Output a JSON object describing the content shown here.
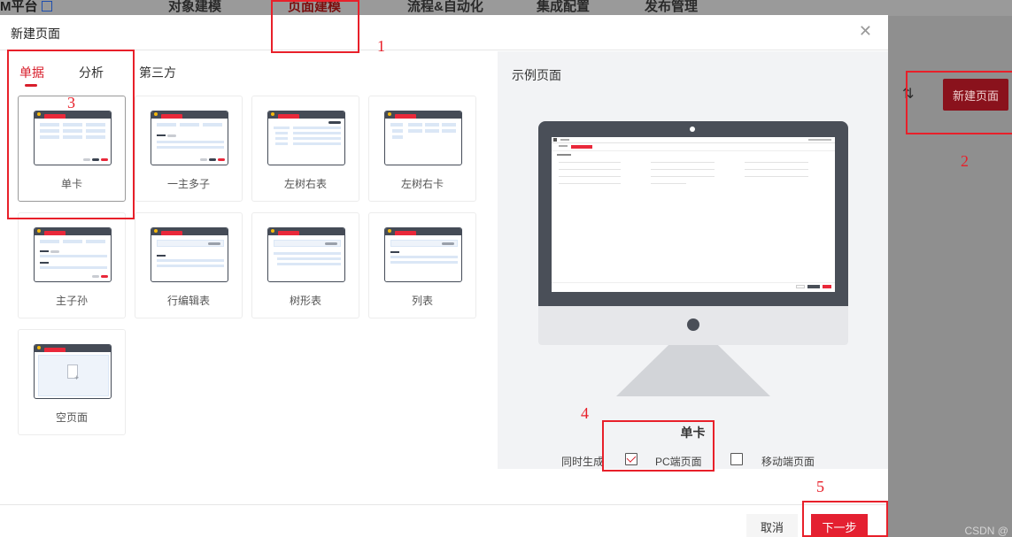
{
  "background": {
    "brand": "M平台",
    "nav": [
      {
        "label": "对象建模",
        "active": false
      },
      {
        "label": "页面建模",
        "active": true
      },
      {
        "label": "流程&自动化",
        "active": false
      },
      {
        "label": "集成配置",
        "active": false
      },
      {
        "label": "发布管理",
        "active": false
      }
    ],
    "new_page_button": "新建页面",
    "watermark": "CSDN @"
  },
  "modal": {
    "title": "新建页面",
    "tabs": [
      {
        "label": "单据",
        "active": true
      },
      {
        "label": "分析",
        "active": false
      },
      {
        "label": "第三方",
        "active": false
      }
    ],
    "templates": [
      {
        "label": "单卡",
        "selected": true
      },
      {
        "label": "一主多子",
        "selected": false
      },
      {
        "label": "左树右表",
        "selected": false
      },
      {
        "label": "左树右卡",
        "selected": false
      },
      {
        "label": "主子孙",
        "selected": false
      },
      {
        "label": "行编辑表",
        "selected": false
      },
      {
        "label": "树形表",
        "selected": false
      },
      {
        "label": "列表",
        "selected": false
      },
      {
        "label": "空页面",
        "selected": false
      }
    ],
    "preview": {
      "title": "示例页面",
      "name": "单卡",
      "generate_label": "同时生成",
      "options": [
        {
          "label": "PC端页面",
          "checked": true
        },
        {
          "label": "移动端页面",
          "checked": false
        }
      ]
    },
    "footer": {
      "cancel": "取消",
      "next": "下一步"
    }
  },
  "annotations": [
    "1",
    "2",
    "3",
    "4",
    "5"
  ],
  "colors": {
    "accent": "#d81e2b",
    "annotation": "#e8202a",
    "frame": "#4a4f58"
  }
}
